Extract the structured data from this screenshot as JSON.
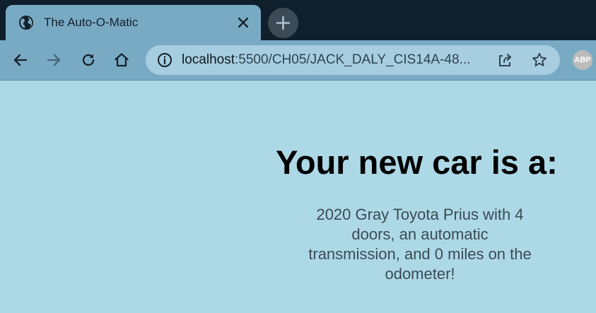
{
  "browser": {
    "tab": {
      "title": "The Auto-O-Matic",
      "favicon": "globe-icon",
      "close_icon": "close-icon"
    },
    "new_tab_icon": "plus-icon",
    "toolbar": {
      "back_icon": "arrow-left-icon",
      "forward_icon": "arrow-right-icon",
      "reload_icon": "reload-icon",
      "home_icon": "home-icon",
      "site_info_icon": "info-icon",
      "url_host": "localhost",
      "url_path": ":5500/CH05/JACK_DALY_CIS14A-48...",
      "share_icon": "share-icon",
      "bookmark_icon": "star-icon",
      "extension_label": "ABP"
    },
    "colors": {
      "tabstrip_bg": "#0f1f2b",
      "active_tab_bg": "#79aac4",
      "omnibox_bg": "#a7cde0",
      "page_bg": "#add8e6"
    }
  },
  "page": {
    "heading": "Your new car is a:",
    "description": "2020 Gray Toyota Prius with 4 doors, an automatic transmission, and 0 miles on the odometer!"
  }
}
